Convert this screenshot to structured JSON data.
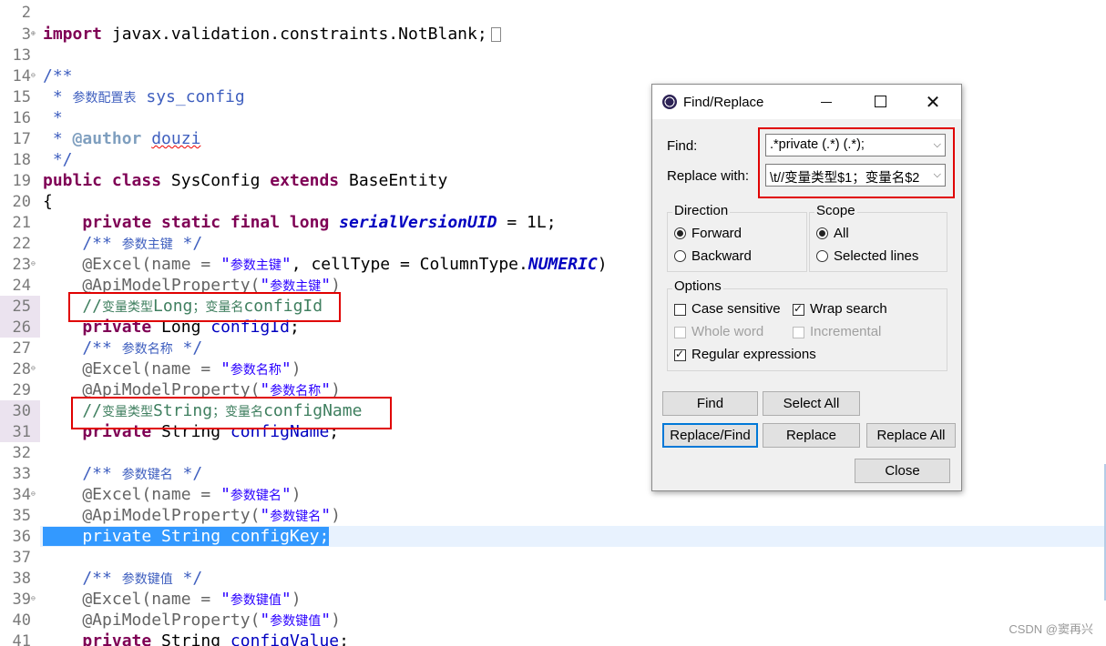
{
  "editor": {
    "line_numbers": [
      "2",
      "3",
      "13",
      "14",
      "15",
      "16",
      "17",
      "18",
      "19",
      "20",
      "21",
      "22",
      "23",
      "24",
      "25",
      "26",
      "27",
      "28",
      "29",
      "30",
      "31",
      "32",
      "33",
      "34",
      "35",
      "36",
      "37",
      "38",
      "39",
      "40",
      "41"
    ],
    "code": {
      "l3_kw": "import",
      "l3_rest": " javax.validation.constraints.NotBlank;",
      "l14": "/**",
      "l15_star": " * ",
      "l15_cn": "参数配置表",
      "l15_en": " sys_config",
      "l16": " *",
      "l17_star": " * ",
      "l17_tag": "@author",
      "l17_sp": " ",
      "l17_name": "douzi",
      "l18": " */",
      "l19_k1": "public",
      "l19_s1": " ",
      "l19_k2": "class",
      "l19_t1": " SysConfig ",
      "l19_k3": "extends",
      "l19_t2": " BaseEntity",
      "l20": "{",
      "l21_pre": "    ",
      "l21_k": "private static final long",
      "l21_sp": " ",
      "l21_f": "serialVersionUID",
      "l21_rest": " = 1L;",
      "l22_a": "    /** ",
      "l22_cn": "参数主键",
      "l22_b": " */",
      "l23_a": "    @Excel(name = ",
      "l23_q1": "\"",
      "l23_cn": "参数主键",
      "l23_q2": "\"",
      "l23_b": ", cellType = ColumnType.",
      "l23_c": "NUMERIC",
      "l23_d": ")",
      "l24_a": "    @ApiModelProperty(",
      "l24_q1": "\"",
      "l24_cn": "参数主键",
      "l24_q2": "\"",
      "l24_b": ")",
      "l25_a": "    //",
      "l25_cn1": "变量类型",
      "l25_b": "Long",
      "l25_cn2": "；变量名",
      "l25_c": "configId",
      "l26_pre": "    ",
      "l26_k": "private",
      "l26_t": " Long ",
      "l26_f": "configId",
      "l26_e": ";",
      "l27_a": "    /** ",
      "l27_cn": "参数名称",
      "l27_b": " */",
      "l28_a": "    @Excel(name = ",
      "l28_q1": "\"",
      "l28_cn": "参数名称",
      "l28_q2": "\"",
      "l28_b": ")",
      "l29_a": "    @ApiModelProperty(",
      "l29_q1": "\"",
      "l29_cn": "参数名称",
      "l29_q2": "\"",
      "l29_b": ")",
      "l30_a": "    //",
      "l30_cn1": "变量类型",
      "l30_b": "String",
      "l30_cn2": "；变量名",
      "l30_c": "configName",
      "l31_pre": "    ",
      "l31_k": "private",
      "l31_t": " String ",
      "l31_f": "configName",
      "l31_e": ";",
      "l33_a": "    /** ",
      "l33_cn": "参数键名",
      "l33_b": " */",
      "l34_a": "    @Excel(name = ",
      "l34_q1": "\"",
      "l34_cn": "参数键名",
      "l34_q2": "\"",
      "l34_b": ")",
      "l35_a": "    @ApiModelProperty(",
      "l35_q1": "\"",
      "l35_cn": "参数键名",
      "l35_q2": "\"",
      "l35_b": ")",
      "l36_pre": "    ",
      "l36_sel": "private String configKey;",
      "l38_a": "    /** ",
      "l38_cn": "参数键值",
      "l38_b": " */",
      "l39_a": "    @Excel(name = ",
      "l39_q1": "\"",
      "l39_cn": "参数键值",
      "l39_q2": "\"",
      "l39_b": ")",
      "l40_a": "    @ApiModelProperty(",
      "l40_q1": "\"",
      "l40_cn": "参数键值",
      "l40_q2": "\"",
      "l40_b": ")",
      "l41_pre": "    ",
      "l41_k": "private",
      "l41_t": " String ",
      "l41_f": "configValue",
      "l41_e": ";"
    }
  },
  "dialog": {
    "title": "Find/Replace",
    "find_label": "Find:",
    "find_value": ".*private (.*) (.*);",
    "replace_label": "Replace with:",
    "replace_value": "\\t//变量类型$1；变量名$2",
    "direction": {
      "title": "Direction",
      "forward": "Forward",
      "backward": "Backward",
      "selected": "Forward"
    },
    "scope": {
      "title": "Scope",
      "all": "All",
      "selected_lines": "Selected lines",
      "selected": "All"
    },
    "options": {
      "title": "Options",
      "case_sensitive": "Case sensitive",
      "wrap_search": "Wrap search",
      "whole_word": "Whole word",
      "incremental": "Incremental",
      "regular_expressions": "Regular expressions",
      "checked": [
        "Wrap search",
        "Regular expressions"
      ],
      "disabled": [
        "Whole word",
        "Incremental"
      ]
    },
    "buttons": {
      "find": "Find",
      "select_all": "Select All",
      "replace_find": "Replace/Find",
      "replace": "Replace",
      "replace_all": "Replace All",
      "close": "Close"
    }
  },
  "watermark": "CSDN @窦再兴",
  "colors": {
    "annotation_box": "#e00000",
    "selection": "#3399ff",
    "current_line": "#e8f2fe"
  }
}
